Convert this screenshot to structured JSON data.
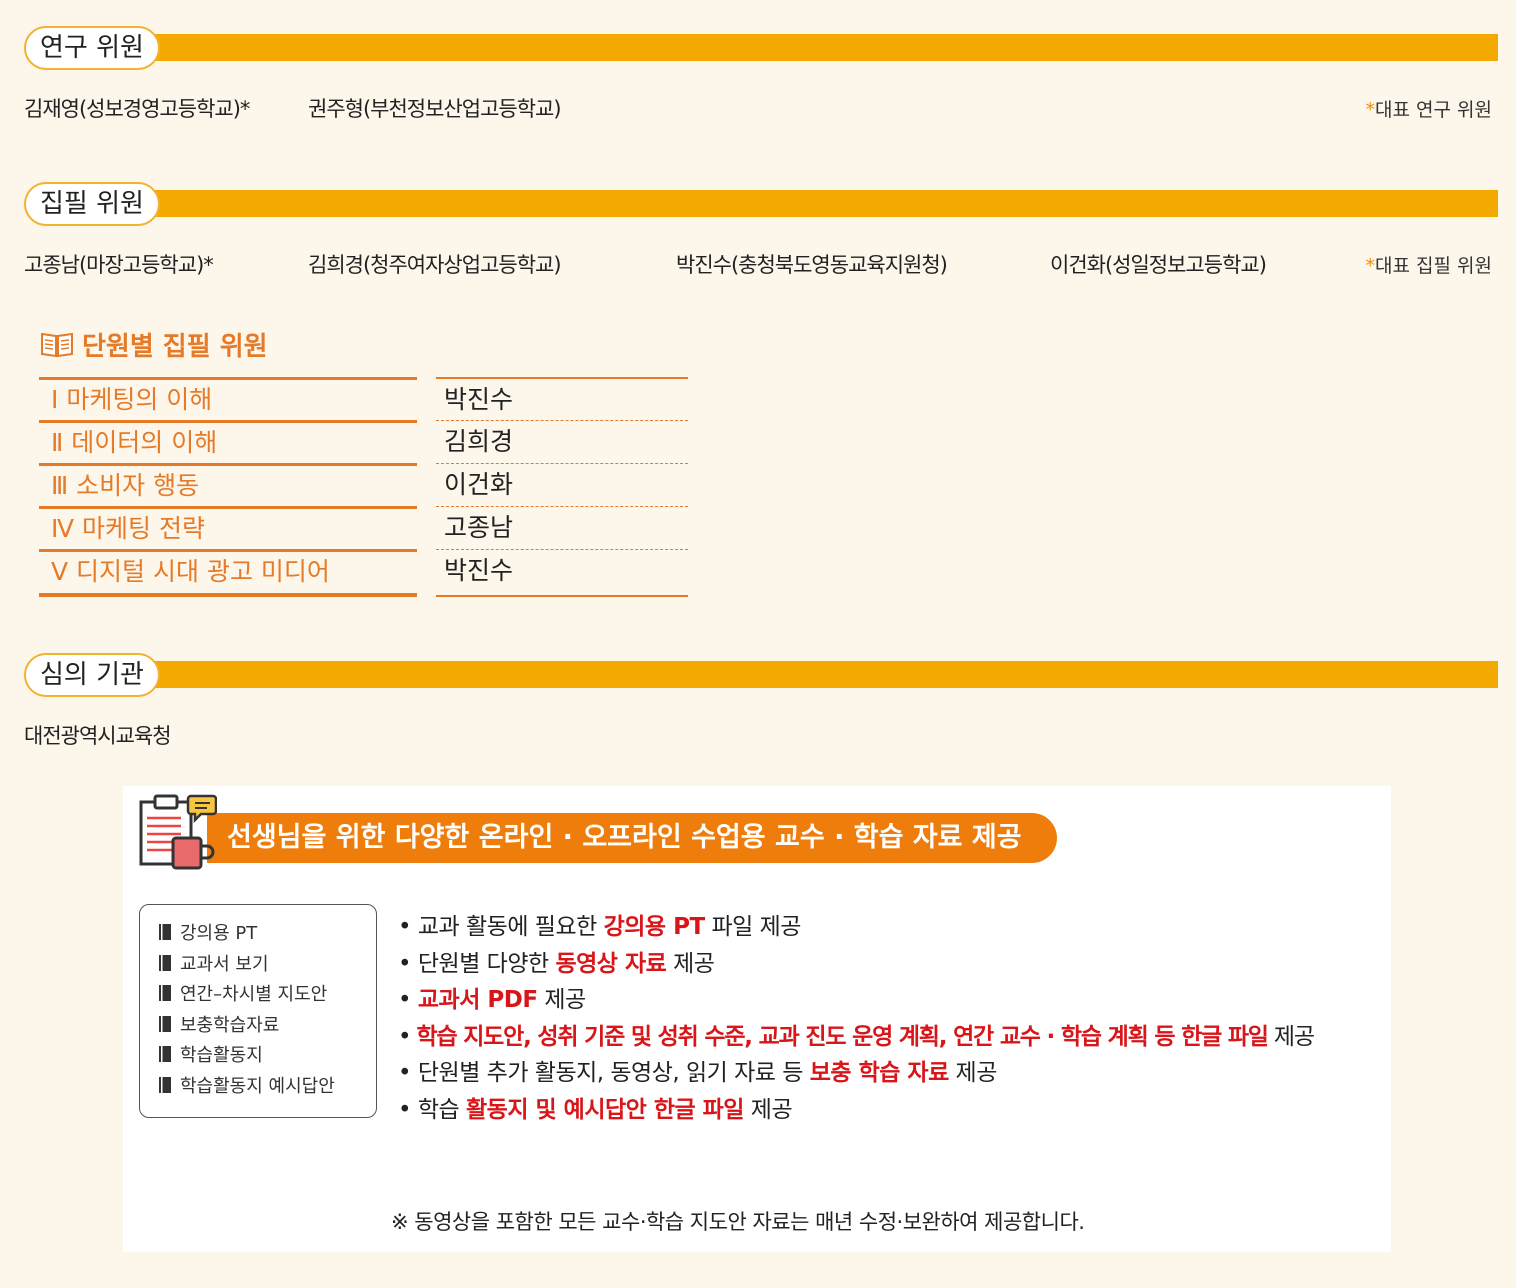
{
  "research": {
    "title": "연구 위원",
    "members": [
      "김재영(성보경영고등학교)*",
      "권주형(부천정보산업고등학교)"
    ],
    "note_star": "*",
    "note_text": "대표 연구 위원"
  },
  "writing": {
    "title": "집필 위원",
    "members": [
      "고종남(마장고등학교)*",
      "김희경(청주여자상업고등학교)",
      "박진수(충청북도영동교육지원청)",
      "이건화(성일정보고등학교)"
    ],
    "note_star": "*",
    "note_text": "대표 집필 위원"
  },
  "units": {
    "title": "단원별 집필 위원",
    "rows": [
      {
        "unit": "Ⅰ 마케팅의 이해",
        "author": "박진수"
      },
      {
        "unit": "Ⅱ 데이터의 이해",
        "author": "김희경"
      },
      {
        "unit": "Ⅲ 소비자 행동",
        "author": "이건화"
      },
      {
        "unit": "Ⅳ 마케팅 전략",
        "author": "고종남"
      },
      {
        "unit": "Ⅴ 디지털 시대 광고 미디어",
        "author": "박진수"
      }
    ]
  },
  "review": {
    "title": "심의 기관",
    "body": "대전광역시교육청"
  },
  "promo": {
    "banner": "선생님을 위한 다양한 온라인 · 오프라인 수업용 교수 · 학습 자료 제공",
    "menu": [
      "강의용 PT",
      "교과서 보기",
      "연간–차시별 지도안",
      "보충학습자료",
      "학습활동지",
      "학습활동지 예시답안"
    ],
    "bullets": [
      {
        "pre": "• 교과 활동에 필요한 ",
        "hl": "강의용 PT",
        "post": " 파일 제공"
      },
      {
        "pre": "• 단원별 다양한 ",
        "hl": "동영상 자료",
        "post": " 제공"
      },
      {
        "pre": "• ",
        "hl": "교과서 PDF",
        "post": " 제공"
      },
      {
        "pre": "• ",
        "hl": "학습 지도안, 성취 기준 및 성취 수준, 교과 진도 운영 계획, 연간 교수 · 학습 계획 등 한글 파일",
        "post": " 제공"
      },
      {
        "pre": "• 단원별 추가 활동지, 동영상, 읽기 자료 등 ",
        "hl": "보충 학습 자료",
        "post": " 제공"
      },
      {
        "pre": "• 학습 ",
        "hl": "활동지 및 예시답안 한글 파일",
        "post": " 제공"
      }
    ],
    "footnote": "※ 동영상을 포함한 모든 교수·학습 지도안 자료는 매년 수정·보완하여 제공합니다."
  },
  "colors": {
    "accent": "#f3a900",
    "orange": "#ef7d0c",
    "unit_orange": "#e57a28",
    "highlight": "#d8161a"
  },
  "icons": [
    "book-icon",
    "clipboard-mug-icon"
  ]
}
